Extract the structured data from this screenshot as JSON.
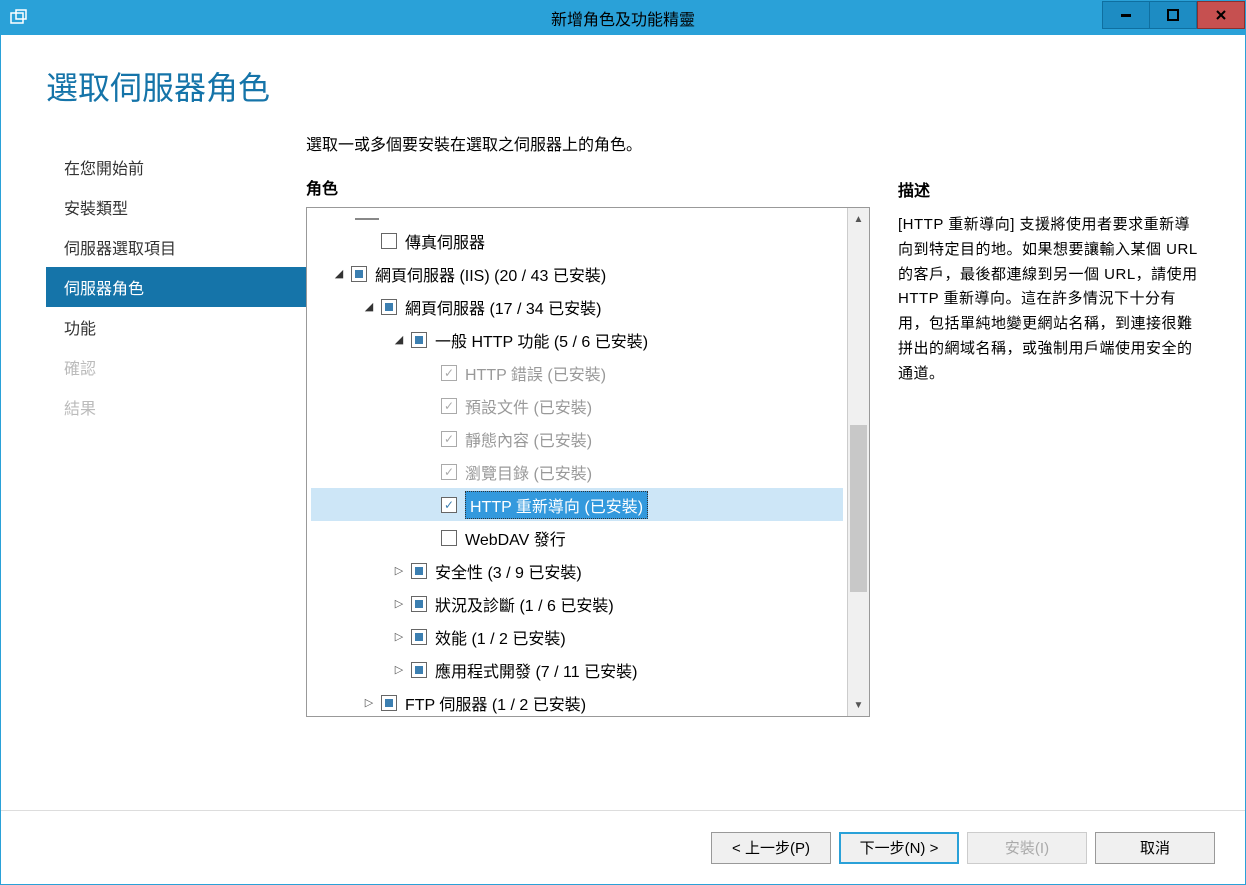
{
  "window": {
    "title": "新增角色及功能精靈"
  },
  "page": {
    "title": "選取伺服器角色",
    "instruction": "選取一或多個要安裝在選取之伺服器上的角色。"
  },
  "sidebar": {
    "items": [
      {
        "label": "在您開始前",
        "state": "normal"
      },
      {
        "label": "安裝類型",
        "state": "normal"
      },
      {
        "label": "伺服器選取項目",
        "state": "normal"
      },
      {
        "label": "伺服器角色",
        "state": "selected"
      },
      {
        "label": "功能",
        "state": "normal"
      },
      {
        "label": "確認",
        "state": "disabled"
      },
      {
        "label": "結果",
        "state": "disabled"
      }
    ]
  },
  "roles": {
    "heading": "角色",
    "tree": [
      {
        "indent": 1,
        "expander": "",
        "check": "empty",
        "label": "傳真伺服器",
        "disabled": false
      },
      {
        "indent": 0,
        "expander": "down",
        "check": "partial",
        "label": "網頁伺服器 (IIS) (20 / 43 已安裝)",
        "disabled": false
      },
      {
        "indent": 1,
        "expander": "down",
        "check": "partial",
        "label": "網頁伺服器 (17 / 34 已安裝)",
        "disabled": false
      },
      {
        "indent": 2,
        "expander": "down",
        "check": "partial",
        "label": "一般 HTTP 功能 (5 / 6 已安裝)",
        "disabled": false
      },
      {
        "indent": 3,
        "expander": "",
        "check": "checked",
        "label": "HTTP 錯誤 (已安裝)",
        "disabled": true
      },
      {
        "indent": 3,
        "expander": "",
        "check": "checked",
        "label": "預設文件 (已安裝)",
        "disabled": true
      },
      {
        "indent": 3,
        "expander": "",
        "check": "checked",
        "label": "靜態內容 (已安裝)",
        "disabled": true
      },
      {
        "indent": 3,
        "expander": "",
        "check": "checked",
        "label": "瀏覽目錄 (已安裝)",
        "disabled": true
      },
      {
        "indent": 3,
        "expander": "",
        "check": "checked",
        "label": "HTTP 重新導向 (已安裝)",
        "disabled": false,
        "selected": true
      },
      {
        "indent": 3,
        "expander": "",
        "check": "empty",
        "label": "WebDAV 發行",
        "disabled": false
      },
      {
        "indent": 2,
        "expander": "right",
        "check": "partial",
        "label": "安全性 (3 / 9 已安裝)",
        "disabled": false
      },
      {
        "indent": 2,
        "expander": "right",
        "check": "partial",
        "label": "狀況及診斷 (1 / 6 已安裝)",
        "disabled": false
      },
      {
        "indent": 2,
        "expander": "right",
        "check": "partial",
        "label": "效能 (1 / 2 已安裝)",
        "disabled": false
      },
      {
        "indent": 2,
        "expander": "right",
        "check": "partial",
        "label": "應用程式開發 (7 / 11 已安裝)",
        "disabled": false
      },
      {
        "indent": 1,
        "expander": "right",
        "check": "partial",
        "label": "FTP 伺服器 (1 / 2 已安裝)",
        "disabled": false
      }
    ]
  },
  "description": {
    "heading": "描述",
    "text": "[HTTP 重新導向] 支援將使用者要求重新導向到特定目的地。如果想要讓輸入某個 URL 的客戶，最後都連線到另一個 URL，請使用 HTTP 重新導向。這在許多情況下十分有用，包括單純地變更網站名稱，到連接很難拼出的網域名稱，或強制用戶端使用安全的通道。"
  },
  "buttons": {
    "prev": "< 上一步(P)",
    "next": "下一步(N) >",
    "install": "安裝(I)",
    "cancel": "取消"
  }
}
